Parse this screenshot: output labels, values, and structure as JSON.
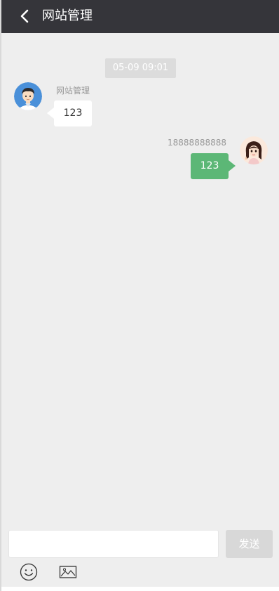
{
  "header": {
    "title": "网站管理",
    "back_icon": "chevron-left-icon"
  },
  "chat": {
    "timestamp": "05-09 09:01",
    "messages": [
      {
        "side": "left",
        "sender": "网站管理",
        "text": "123",
        "avatar": "male-avatar"
      },
      {
        "side": "right",
        "sender": "18888888888",
        "text": "123",
        "avatar": "female-avatar"
      }
    ]
  },
  "composer": {
    "input_value": "",
    "placeholder": "",
    "send_label": "发送",
    "emoji_icon": "smiley-icon",
    "image_icon": "image-icon"
  },
  "colors": {
    "header_bg": "#35353a",
    "page_bg": "#eeeeee",
    "own_bubble": "#5cb776",
    "other_bubble": "#ffffff",
    "send_button": "#d8d8d8"
  }
}
